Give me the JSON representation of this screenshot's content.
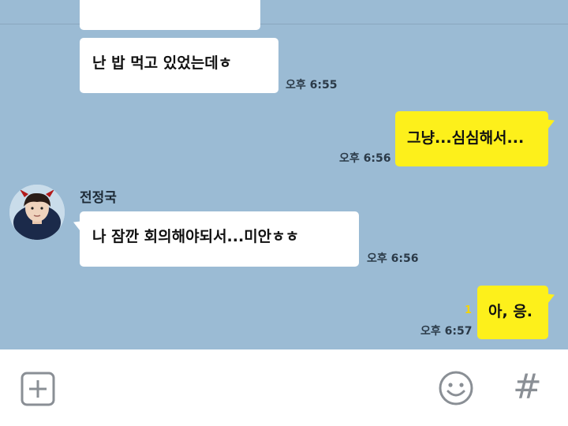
{
  "messages": [
    {
      "text": "난 밥 먹고 있었는데ㅎ",
      "time": "오후 6:55"
    },
    {
      "text": "그냥...심심해서...",
      "time": "오후 6:56"
    },
    {
      "sender": "전정국",
      "text": "나 잠깐 회의해야되서...미안ㅎㅎ",
      "time": "오후 6:56"
    },
    {
      "text": "아, 응.",
      "time": "오후 6:57",
      "unread": "1"
    }
  ],
  "toolbar": {
    "attach_icon": "plus-box-icon",
    "emoji_icon": "smiley-icon",
    "hashtag_icon": "hash-icon",
    "hashtag_label": "#"
  },
  "colors": {
    "background": "#9bbbd4",
    "incoming_bubble": "#ffffff",
    "outgoing_bubble": "#fdf01b",
    "unread": "#f5d400",
    "icon": "#8a8f95"
  }
}
